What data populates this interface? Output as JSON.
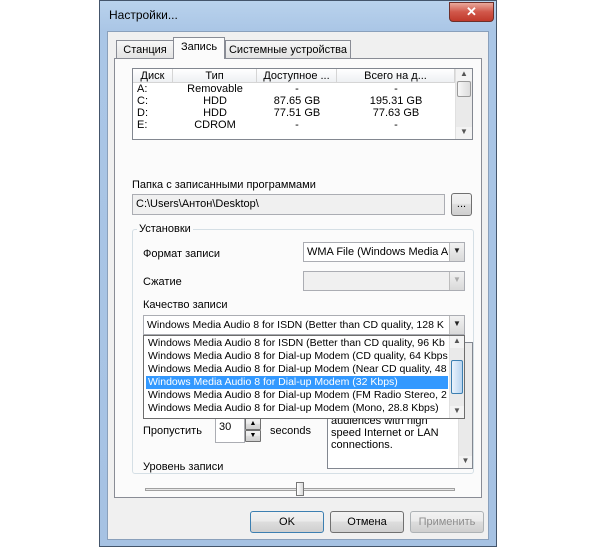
{
  "window": {
    "title": "Настройки...",
    "close_glyph": "✕"
  },
  "tabs": [
    {
      "label": "Станция",
      "active": false
    },
    {
      "label": "Запись",
      "active": true
    },
    {
      "label": "Системные устройства",
      "active": false
    }
  ],
  "disk_list": {
    "columns": [
      "Диск",
      "Тип",
      "Доступное ...",
      "Всего на д..."
    ],
    "rows": [
      {
        "disk": "A:",
        "type": "Removable",
        "free": "-",
        "total": "-"
      },
      {
        "disk": "C:",
        "type": "HDD",
        "free": "87.65 GB",
        "total": "195.31 GB"
      },
      {
        "disk": "D:",
        "type": "HDD",
        "free": "77.51 GB",
        "total": "77.63 GB"
      },
      {
        "disk": "E:",
        "type": "CDROM",
        "free": "-",
        "total": "-"
      }
    ]
  },
  "folder": {
    "label": "Папка с записанными программами",
    "value": "C:\\Users\\Антон\\Desktop\\",
    "browse_label": "..."
  },
  "settings": {
    "group_label": "Установки",
    "format_label": "Формат записи",
    "format_value": "WMA File (Windows Media Au",
    "compression_label": "Сжатие",
    "compression_value": "",
    "quality_label": "Качество записи",
    "quality_value": "Windows Media Audio 8 for ISDN (Better than CD quality, 128 K",
    "quality_options": [
      "Windows Media Audio 8 for ISDN (Better than CD quality, 96 Kb",
      "Windows Media Audio 8 for Dial-up Modem (CD quality, 64 Kbps",
      "Windows Media Audio 8 for Dial-up Modem (Near CD quality, 48",
      "Windows Media Audio 8 for Dial-up Modem (32 Kbps)",
      "Windows Media Audio 8 for Dial-up Modem (FM Radio Stereo, 2",
      "Windows Media Audio 8 for Dial-up Modem (Mono, 28.8 Kbps)"
    ],
    "quality_selected_index": 3,
    "skip_label": "Пропустить",
    "skip_value": "30",
    "skip_unit": "seconds",
    "description_lines": [
      "audiences with high",
      "speed Internet or LAN",
      "connections."
    ],
    "level_label": "Уровень записи",
    "level_value": 0.5
  },
  "buttons": {
    "ok": "OK",
    "cancel": "Отмена",
    "apply": "Применить"
  },
  "icons": {
    "dropdown": "chevron-down-icon",
    "spin_up": "spin-up-icon",
    "spin_down": "spin-down-icon"
  }
}
